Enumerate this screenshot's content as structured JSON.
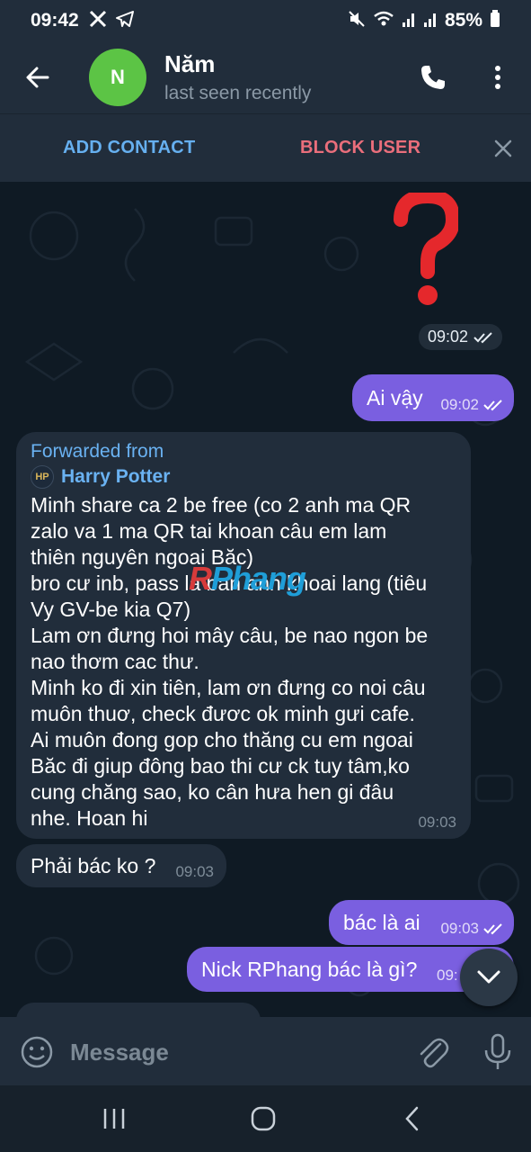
{
  "status_bar": {
    "time": "09:42",
    "battery": "85%",
    "icons": [
      "x-logo-icon",
      "telegram-icon",
      "mute-icon",
      "wifi-icon",
      "signal-icon",
      "signal-icon",
      "battery-icon"
    ]
  },
  "header": {
    "avatar_initial": "N",
    "avatar_color": "#5cc445",
    "contact_name": "Năm",
    "contact_status": "last seen recently"
  },
  "action_bar": {
    "add_contact": "ADD CONTACT",
    "block_user": "BLOCK USER"
  },
  "messages": [
    {
      "kind": "sticker",
      "sticker": "red-question-mark",
      "time": "09:02",
      "direction": "out",
      "read": true
    },
    {
      "kind": "text",
      "direction": "out",
      "text": "Ai vậy",
      "time": "09:02",
      "read": true
    },
    {
      "kind": "forwarded",
      "direction": "in",
      "forwarded_label": "Forwarded from",
      "forwarded_source": "Harry Potter",
      "source_avatar_text": "HP",
      "lines": [
        "Minh share ca 2 be free (co 2 anh ma QR",
        "zalo va 1 ma QR tai khoan câu em lam",
        "thiên nguyên ngoai Băc)",
        "bro cư inb, pass la ban anh khoai lang (tiêu",
        "Vy GV-be kia Q7)",
        "Lam ơn đưng hoi mây câu, be nao ngon be",
        "nao thơm cac thư.",
        "Minh ko đi xin tiên, lam ơn đưng co noi câu",
        "muôn thuơ, check đươc ok minh gưi cafe.",
        "Ai muôn đong gop cho thăng cu em ngoai",
        "Băc đi giup đông bao thi cư ck tuy tâm,ko",
        "cung chăng sao, ko cân hưa hen gi đâu",
        "nhe. Hoan hi"
      ],
      "time": "09:03"
    },
    {
      "kind": "text",
      "direction": "in",
      "text": "Phải bác ko ?",
      "time": "09:03"
    },
    {
      "kind": "text",
      "direction": "out",
      "text": "bác là ai",
      "time": "09:03",
      "read": true
    },
    {
      "kind": "text",
      "direction": "out",
      "text": "Nick RPhang bác là gì?",
      "time": "09:",
      "read": true
    }
  ],
  "watermark": {
    "r": "R",
    "rest": "Phang"
  },
  "input": {
    "placeholder": "Message"
  },
  "colors": {
    "outgoing_bubble": "#7a5fe0",
    "incoming_bubble": "#212d3b",
    "link_blue": "#6ab2f2",
    "block_red": "#ea6e7b",
    "chat_bg": "#0f1a24"
  }
}
